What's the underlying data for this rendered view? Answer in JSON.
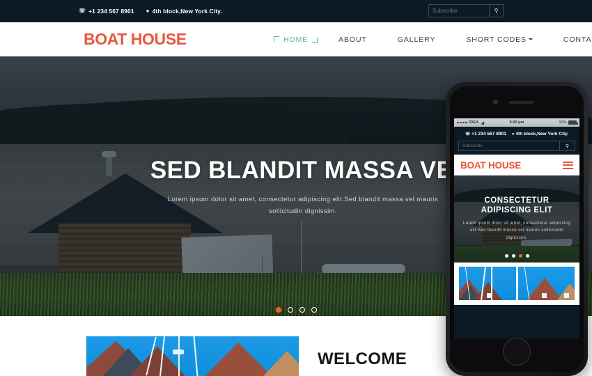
{
  "colors": {
    "topbar_bg": "#0b1a24",
    "logo_orange": "#e8573f",
    "nav_active_teal": "#57b999",
    "accent_dot": "#f26322",
    "nav_text": "#3d4448"
  },
  "topbar": {
    "phone_icon": "phone-icon",
    "phone": "+1 234 567 8901",
    "location_icon": "location-pin-icon",
    "address": "4th block,New York City.",
    "subscribe_placeholder": "Subscribe",
    "subscribe_value": "",
    "search_icon": "search-icon"
  },
  "nav": {
    "logo": "BOAT HOUSE",
    "items": [
      {
        "label": "HOME",
        "active": true,
        "dropdown": false
      },
      {
        "label": "ABOUT",
        "active": false,
        "dropdown": false
      },
      {
        "label": "GALLERY",
        "active": false,
        "dropdown": false
      },
      {
        "label": "SHORT CODES",
        "active": false,
        "dropdown": true
      },
      {
        "label": "CONTACT",
        "active": false,
        "dropdown": false
      }
    ]
  },
  "hero": {
    "title": "SED BLANDIT MASSA VEL",
    "subtitle": "Lorem ipsum dolor sit amet, consectetur adipiscing elit.Sed blandit massa vel mauris sollicitudin dignissim.",
    "dots": 4,
    "active_dot": 0
  },
  "welcome": {
    "title": "WELCOME"
  },
  "phone": {
    "status": {
      "carrier": "IDEA",
      "wifi_icon": "wifi-icon",
      "time": "9:20 pm",
      "battery": "90%"
    },
    "topbar": {
      "phone_icon": "phone-icon",
      "phone": "+1 234 567 8901",
      "location_icon": "location-pin-icon",
      "address": "4th block,New York City.",
      "subscribe_placeholder": "Subscribe",
      "search_icon": "search-icon"
    },
    "nav": {
      "logo": "BOAT HOUSE",
      "menu_icon": "hamburger-menu-icon"
    },
    "hero": {
      "title_line1": "CONSECTETUR",
      "title_line2": "ADIPISCING ELIT",
      "subtitle": "Lorem ipsum dolor sit amet, consectetur adipiscing elit.Sed blandit massa vel mauris sollicitudin dignissim.",
      "dots": 4,
      "active_dot": 2
    }
  }
}
